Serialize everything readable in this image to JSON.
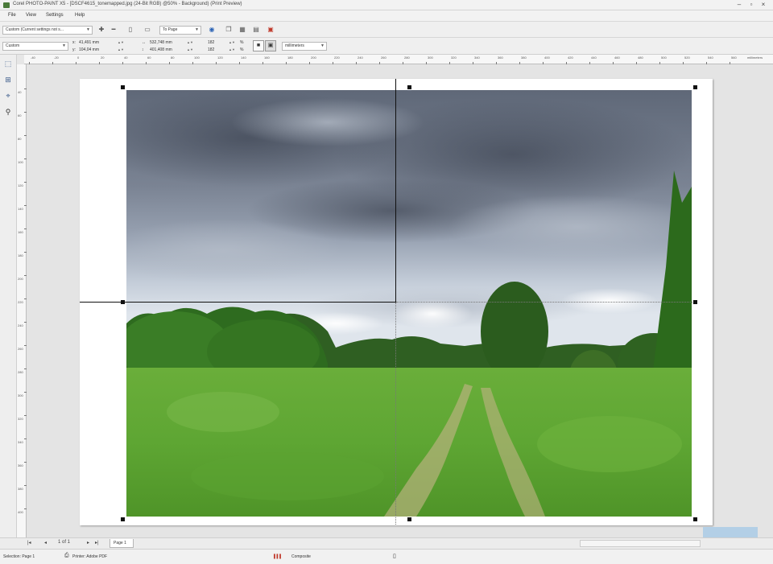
{
  "window": {
    "title": "Corel PHOTO-PAINT X5 - [DSCF4615_tonemapped.jpg (24-Bit RGB) @50% - Background) (Print Preview)",
    "controls": [
      "–",
      "▫",
      "×"
    ]
  },
  "menu": {
    "items": [
      "File",
      "View",
      "Settings",
      "Help"
    ]
  },
  "toolbar1": {
    "preset_value": "Custom (Current settings not s...",
    "fit_value": "To Page"
  },
  "toolbar2": {
    "layout_value": "Custom",
    "x_pos": "41,491 mm",
    "y_pos": "104,04 mm",
    "width": "532,748 mm",
    "height": "401,408 mm",
    "scale_x": "182",
    "scale_y": "182",
    "percent": "%",
    "units_value": "millimeters"
  },
  "ruler": {
    "h_labels": [
      "-40",
      "-20",
      "0",
      "20",
      "40",
      "60",
      "80",
      "100",
      "120",
      "140",
      "160",
      "180",
      "200",
      "220",
      "240",
      "260",
      "280",
      "300",
      "320",
      "340",
      "360",
      "380",
      "400",
      "420",
      "440",
      "460",
      "480",
      "500",
      "520",
      "540",
      "560"
    ],
    "unit": "millimeters",
    "v_labels": [
      "40",
      "60",
      "80",
      "100",
      "120",
      "140",
      "160",
      "180",
      "200",
      "220",
      "240",
      "260",
      "280",
      "300",
      "320",
      "340",
      "360",
      "380",
      "400"
    ]
  },
  "pagenav": {
    "first": "|◂",
    "prev": "◂",
    "counter": "1 of 1",
    "next": "▸",
    "last": "▸|",
    "tab_label": "Page 1"
  },
  "status": {
    "selection": "Selection: Page 1",
    "printer": "Printer: Adobe PDF",
    "composite": "Composite"
  },
  "colors": {
    "accent": "#b3cfe6",
    "guide": "#111111"
  }
}
